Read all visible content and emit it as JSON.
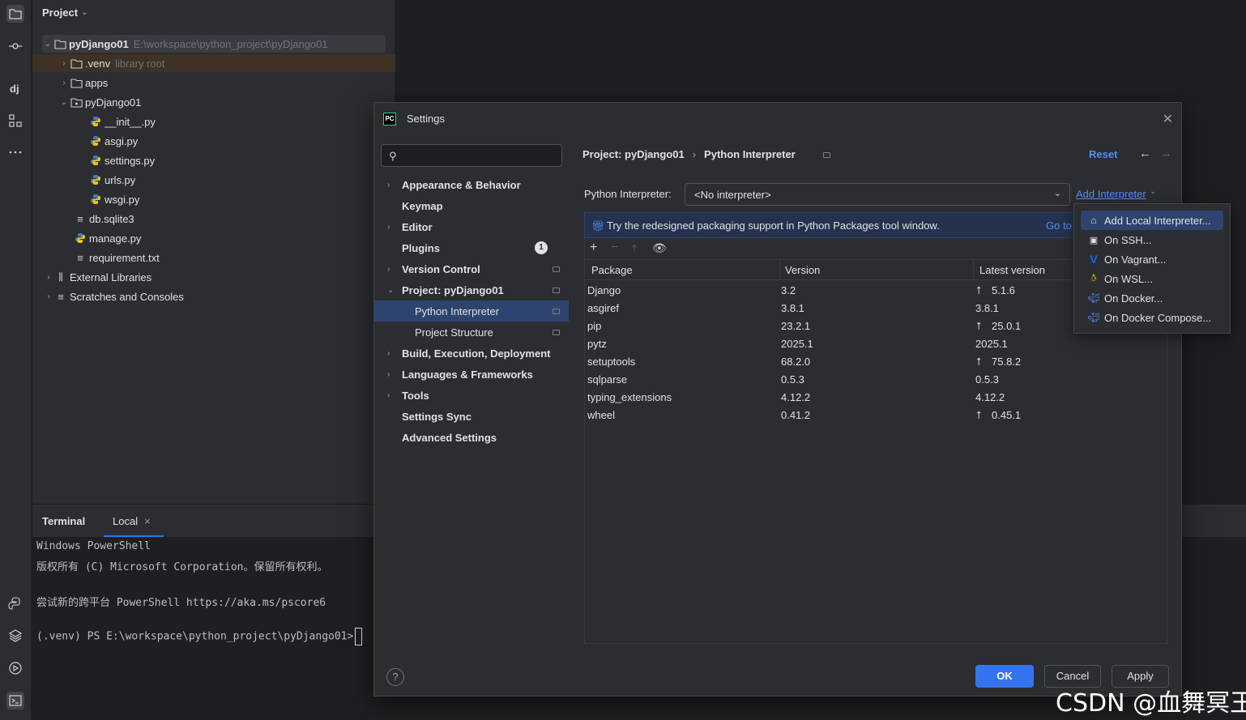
{
  "project_panel": {
    "title": "Project",
    "tree": [
      {
        "label": "pyDjango01",
        "hint": "E:\\workspace\\python_project\\pyDjango01",
        "type": "folder",
        "expanded": true
      },
      {
        "label": ".venv",
        "hint": "library root",
        "type": "folder",
        "expanded": false
      },
      {
        "label": "apps",
        "type": "folder",
        "expanded": false
      },
      {
        "label": "pyDjango01",
        "type": "package",
        "expanded": true
      },
      {
        "label": "__init__.py",
        "type": "python"
      },
      {
        "label": "asgi.py",
        "type": "python"
      },
      {
        "label": "settings.py",
        "type": "python"
      },
      {
        "label": "urls.py",
        "type": "python"
      },
      {
        "label": "wsgi.py",
        "type": "python"
      },
      {
        "label": "db.sqlite3",
        "type": "text"
      },
      {
        "label": "manage.py",
        "type": "python"
      },
      {
        "label": "requirement.txt",
        "type": "text"
      },
      {
        "label": "External Libraries",
        "type": "library",
        "expanded": false
      },
      {
        "label": "Scratches and Consoles",
        "type": "scratch",
        "expanded": false
      }
    ]
  },
  "terminal": {
    "title": "Terminal",
    "tab": "Local",
    "lines": [
      "Windows PowerShell",
      "版权所有 (C) Microsoft Corporation。保留所有权利。",
      "",
      "尝试新的跨平台 PowerShell https://aka.ms/pscore6",
      "",
      "(.venv) PS E:\\workspace\\python_project\\pyDjango01>"
    ]
  },
  "dialog": {
    "title": "Settings",
    "search_placeholder": "",
    "nav": [
      {
        "label": "Appearance & Behavior",
        "arrow": "›"
      },
      {
        "label": "Keymap"
      },
      {
        "label": "Editor",
        "arrow": "›"
      },
      {
        "label": "Plugins",
        "badge": "1"
      },
      {
        "label": "Version Control",
        "arrow": "›"
      },
      {
        "label": "Project: pyDjango01",
        "arrow": "⌄"
      },
      {
        "label": "Python Interpreter"
      },
      {
        "label": "Project Structure"
      },
      {
        "label": "Build, Execution, Deployment",
        "arrow": "›"
      },
      {
        "label": "Languages & Frameworks",
        "arrow": "›"
      },
      {
        "label": "Tools",
        "arrow": "›"
      },
      {
        "label": "Settings Sync"
      },
      {
        "label": "Advanced Settings"
      }
    ],
    "breadcrumb": [
      "Project: pyDjango01",
      "Python Interpreter"
    ],
    "breadcrumb_sep": "›",
    "reset": "Reset",
    "interpreter_label": "Python Interpreter:",
    "interpreter_value": "<No interpreter>",
    "add_interpreter": "Add Interpreter",
    "banner_text": "Try the redesigned packaging support in Python Packages tool window.",
    "banner_link": "Go to",
    "columns": [
      "Package",
      "Version",
      "Latest version"
    ],
    "packages": [
      {
        "name": "Django",
        "version": "3.2",
        "latest": "5.1.6",
        "upgrade": true
      },
      {
        "name": "asgiref",
        "version": "3.8.1",
        "latest": "3.8.1",
        "upgrade": false
      },
      {
        "name": "pip",
        "version": "23.2.1",
        "latest": "25.0.1",
        "upgrade": true
      },
      {
        "name": "pytz",
        "version": "2025.1",
        "latest": "2025.1",
        "upgrade": false
      },
      {
        "name": "setuptools",
        "version": "68.2.0",
        "latest": "75.8.2",
        "upgrade": true
      },
      {
        "name": "sqlparse",
        "version": "0.5.3",
        "latest": "0.5.3",
        "upgrade": false
      },
      {
        "name": "typing_extensions",
        "version": "4.12.2",
        "latest": "4.12.2",
        "upgrade": false
      },
      {
        "name": "wheel",
        "version": "0.41.2",
        "latest": "0.45.1",
        "upgrade": true
      }
    ],
    "buttons": {
      "ok": "OK",
      "cancel": "Cancel",
      "apply": "Apply",
      "help": "?"
    }
  },
  "add_interpreter_menu": [
    {
      "label": "Add Local Interpreter...",
      "icon": "home-icon",
      "color": "#ced0d6"
    },
    {
      "label": "On SSH...",
      "icon": "terminal-icon",
      "color": "#ced0d6"
    },
    {
      "label": "On Vagrant...",
      "icon": "vagrant-icon",
      "color": "#1868f2"
    },
    {
      "label": "On WSL...",
      "icon": "linux-icon",
      "color": "#f0c000"
    },
    {
      "label": "On Docker...",
      "icon": "docker-icon",
      "color": "#548af7"
    },
    {
      "label": "On Docker Compose...",
      "icon": "docker-icon",
      "color": "#548af7"
    }
  ],
  "watermark": "CSDN @血舞冥王",
  "colors": {
    "accent": "#3574f0",
    "link": "#548af7",
    "selection": "#2e436e",
    "background": "#2b2d30"
  }
}
